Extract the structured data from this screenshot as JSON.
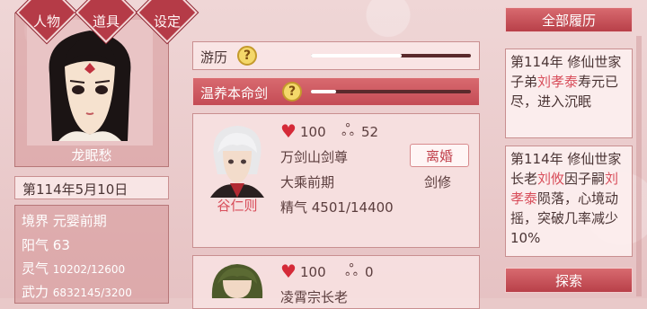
{
  "menu": {
    "character": "人物",
    "items": "道具",
    "settings": "设定"
  },
  "profile": {
    "name": "龙眠愁",
    "date": "第114年5月10日",
    "realm_label": "境界",
    "realm_value": "元婴前期",
    "yang_label": "阳气",
    "yang_value": "63",
    "spirit_label": "灵气",
    "spirit_value": "10202/12600",
    "force_label": "武力",
    "force_value": "6832145/3200"
  },
  "activities": [
    {
      "label": "游历",
      "progress": 0.57
    },
    {
      "label": "温养本命剑",
      "progress": 0.16
    }
  ],
  "companions": [
    {
      "name": "谷仁则",
      "hp": "100",
      "bond": "52",
      "sect": "万剑山剑尊",
      "realm": "大乘前期",
      "essence": "精气 4501/14400",
      "action": "离婚",
      "path": "剑修"
    },
    {
      "hp": "100",
      "bond": "0",
      "sect": "凌霄宗长老"
    }
  ],
  "history": {
    "title": "全部履历",
    "entries": [
      {
        "pre": "第114年 修仙世家子弟",
        "name": "刘孝泰",
        "post": "寿元已尽，进入沉眠"
      },
      {
        "pre": "第114年 修仙世家长老",
        "name": "刘攸",
        "mid": "因子嗣",
        "name2": "刘孝泰",
        "post": "陨落，心境动摇，突破几率减少10%"
      }
    ],
    "explore": "探索"
  },
  "colors": {
    "accent": "#b53b47",
    "highlight": "#d84d5a",
    "heart": "#d52a38"
  }
}
